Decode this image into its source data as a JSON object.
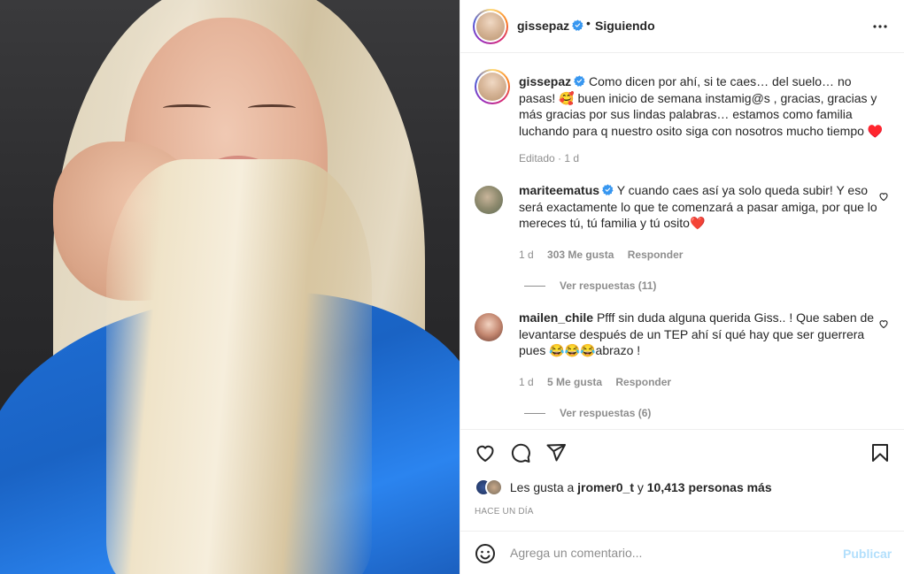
{
  "header": {
    "username": "gissepaz",
    "separator": "•",
    "follow_label": "Siguiendo"
  },
  "caption": {
    "username": "gissepaz",
    "text": "Como dicen por ahí, si te caes… del suelo… no pasas! 🥰 buen inicio de semana instamig@s , gracias, gracias y más gracias por sus lindas palabras… estamos como familia luchando para q nuestro osito siga con nosotros mucho tiempo ♥️",
    "meta": "Editado · 1 d"
  },
  "comments": [
    {
      "username": "mariteematus",
      "text": "Y cuando caes así ya solo queda subir! Y eso será exactamente lo que te comenzará a pasar amiga, por que lo mereces tú, tú familia y tú osito❤️",
      "time": "1 d",
      "likes": "303 Me gusta",
      "reply_label": "Responder",
      "view_replies": "Ver respuestas (11)"
    },
    {
      "username": "mailen_chile",
      "text": "Pfff sin duda alguna querida Giss.. ! Que saben de levantarse después de un TEP ahí sí qué hay que ser guerrera pues 😂😂😂abrazo !",
      "time": "1 d",
      "likes": "5 Me gusta",
      "reply_label": "Responder",
      "view_replies": "Ver respuestas (6)"
    }
  ],
  "likes_line": {
    "prefix": "Les gusta a",
    "user": "jromer0_t",
    "middle": "y",
    "count": "10,413 personas más"
  },
  "time_ago": "HACE UN DÍA",
  "add_comment": {
    "placeholder": "Agrega un comentario...",
    "publish_label": "Publicar"
  },
  "colors": {
    "verified": "#3897f0",
    "publish_disabled": "#b2dffc",
    "meta_gray": "#8e8e8e",
    "text": "#262626"
  },
  "icons": [
    "verified-icon",
    "more-options-icon",
    "heart-icon",
    "comment-icon",
    "share-icon",
    "bookmark-icon",
    "emoji-icon"
  ]
}
